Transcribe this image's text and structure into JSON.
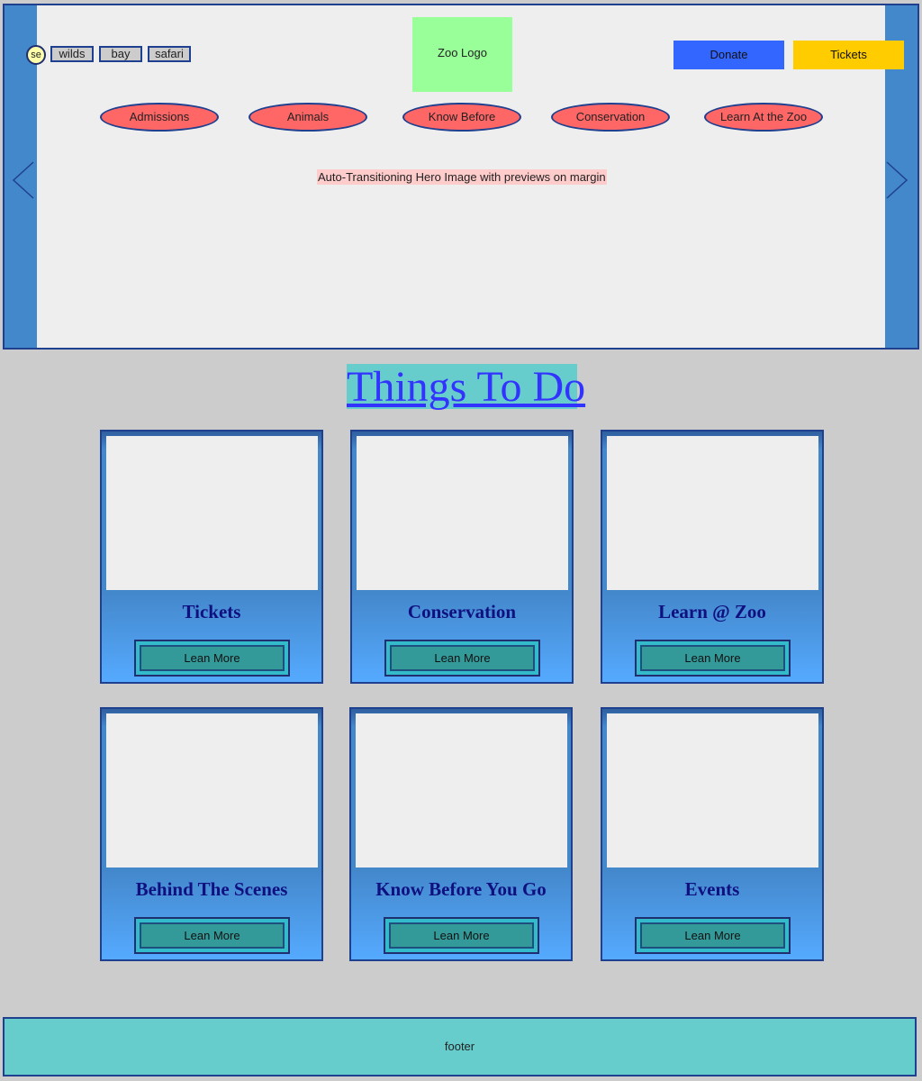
{
  "header": {
    "search_label": "se",
    "mini_tabs": [
      "wilds",
      "bay",
      "safari"
    ],
    "logo_text": "Zoo Logo",
    "donate_label": "Donate",
    "tickets_label": "Tickets",
    "nav": [
      "Admissions",
      "Animals",
      "Know Before",
      "Conservation",
      "Learn At the Zoo"
    ],
    "hero_caption": "Auto-Transitioning Hero Image with previews on margin"
  },
  "section": {
    "title": "Things To Do"
  },
  "cards": [
    {
      "title": "Tickets",
      "button": "Lean More"
    },
    {
      "title": "Conservation",
      "button": "Lean More"
    },
    {
      "title": "Learn @ Zoo",
      "button": "Lean More"
    },
    {
      "title": "Behind The Scenes",
      "button": "Lean More"
    },
    {
      "title": "Know Before You Go",
      "button": "Lean More"
    },
    {
      "title": "Events",
      "button": "Lean More"
    }
  ],
  "footer": {
    "text": "footer"
  },
  "colors": {
    "hero_margin": "#4488cc",
    "donate": "#3366ff",
    "tickets": "#ffcc00",
    "nav_pill": "#ff6666",
    "logo_bg": "#99ff99",
    "heading_bg": "#66cccc",
    "heading_link": "#3333ff",
    "card_button": "#339999",
    "footer_bg": "#66cccc",
    "page_bg": "#cccccc"
  },
  "icons": {
    "prev": "chevron-left-icon",
    "next": "chevron-right-icon",
    "search": "search-icon"
  }
}
